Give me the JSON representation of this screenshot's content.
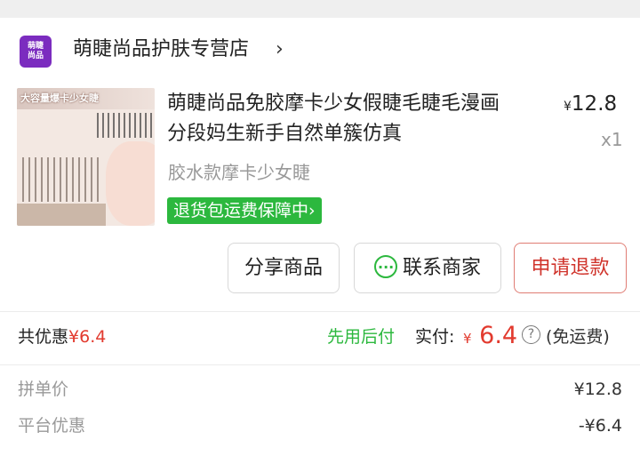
{
  "store": {
    "logo_text_1": "萌睫",
    "logo_text_2": "尚品",
    "name": "萌睫尚品护肤专营店",
    "chevron": "›"
  },
  "product": {
    "thumb_banner": "大容量爆卡少女睫",
    "title_line1": "萌睫尚品免胶摩卡少女假睫毛睫毛漫画",
    "title_line2": "分段妈生新手自然单簇仿真",
    "price_symbol": "¥",
    "price": "12.8",
    "quantity": "x1",
    "variant": "胶水款摩卡少女睫",
    "guarantee_badge": "退货包运费保障中"
  },
  "actions": {
    "share": "分享商品",
    "contact": "联系商家",
    "refund": "申请退款"
  },
  "summary": {
    "discount_label": "共优惠",
    "discount_value": "¥6.4",
    "pay_later": "先用后付",
    "paid_label": "实付:",
    "paid_symbol": "¥",
    "paid_value": "6.4",
    "help": "?",
    "free_shipping": "(免运费)"
  },
  "details": [
    {
      "label": "拼单价",
      "value": "¥12.8"
    },
    {
      "label": "平台优惠",
      "value": "-¥6.4"
    }
  ],
  "colors": {
    "accent_red": "#e23a2e",
    "accent_green": "#2cb83e",
    "store_logo": "#7b2cbf"
  }
}
